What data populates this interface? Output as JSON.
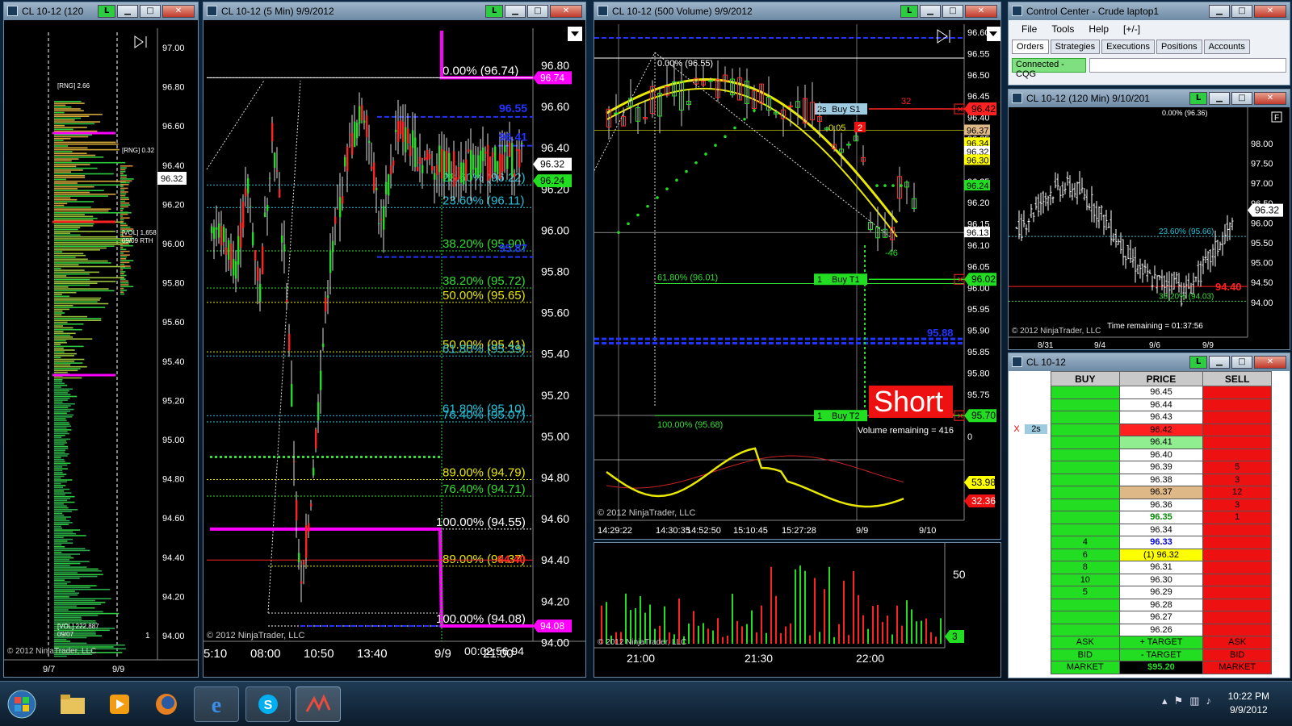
{
  "win1": {
    "title": "CL 10-12 (120",
    "prices": [
      "97.00",
      "96.80",
      "96.60",
      "96.40",
      "96.20",
      "96.00",
      "95.80",
      "95.60",
      "95.40",
      "95.20",
      "95.00",
      "94.80",
      "94.60",
      "94.40",
      "94.20",
      "94.00"
    ],
    "last": "96.32",
    "rng1": "[RNG] 2.66",
    "rng2": "[RNG] 0.32",
    "vol1": "[VOL] 1,658",
    "vol1b": "09/09 RTH",
    "vol2": "[VOL] 222,887",
    "vol2b": "09/07",
    "one": "1",
    "dates": [
      "9/7",
      "9/9"
    ],
    "copyright": "© 2012 NinjaTrader, LLC"
  },
  "win2": {
    "title": "CL 10-12 (5 Min)  9/9/2012",
    "prices": [
      "96.80",
      "96.60",
      "96.40",
      "96.20",
      "96.00",
      "95.80",
      "95.60",
      "95.40",
      "95.20",
      "95.00",
      "94.80",
      "94.60",
      "94.40",
      "94.20",
      "94.00"
    ],
    "times": [
      "5:10",
      "08:00",
      "10:50",
      "13:40",
      "9/9",
      "21:00"
    ],
    "fibs": [
      {
        "label": "0.00% (96.74)",
        "color": "#ffffff"
      },
      {
        "label": "23.60% (96.22)",
        "color": "#27c1d9"
      },
      {
        "label": "23.60% (96.11)",
        "color": "#27c1d9"
      },
      {
        "label": "38.20% (95.90)",
        "color": "#33dd33"
      },
      {
        "label": "38.20% (95.72)",
        "color": "#33dd33"
      },
      {
        "label": "50.00% (95.65)",
        "color": "#e8e800"
      },
      {
        "label": "50.00% (95.41)",
        "color": "#e8e800"
      },
      {
        "label": "61.80% (95.39)",
        "color": "#27c1d9"
      },
      {
        "label": "61.80% (95.10)",
        "color": "#27c1d9"
      },
      {
        "label": "76.40% (95.07)",
        "color": "#27c1d9"
      },
      {
        "label": "89.00% (94.79)",
        "color": "#e8e800"
      },
      {
        "label": "76.40% (94.71)",
        "color": "#33dd33"
      },
      {
        "label": "100.00% (94.55)",
        "color": "#ffffff"
      },
      {
        "label": "89.00% (94.37)",
        "color": "#e8e800"
      },
      {
        "label": "100.00% (94.08)",
        "color": "#ffffff"
      }
    ],
    "tags": {
      "hi": "96.74",
      "last": "96.32",
      "green": "96.24",
      "lo": "94.08",
      "b1": "96.55",
      "b2": "96.41",
      "b3": "95.87",
      "red": "94.40"
    },
    "timer": "00:02:56.94",
    "copyright": "© 2012 NinjaTrader, LLC"
  },
  "win3": {
    "title": "CL 10-12 (500 Volume)  9/9/2012",
    "prices": [
      "96.60",
      "96.55",
      "96.50",
      "96.45",
      "96.40",
      "96.35",
      "96.30",
      "96.25",
      "96.20",
      "96.15",
      "96.10",
      "96.05",
      "96.00",
      "95.95",
      "95.90",
      "95.85",
      "95.80",
      "95.75"
    ],
    "fib_top": "0.00% (96.55)",
    "fib_mid": "61.80% (96.01)",
    "fib_bot": "100.00% (95.68)",
    "orders": [
      {
        "qty": "2s",
        "label": "Buy S1",
        "price": "96.42",
        "color": "#ff2222"
      },
      {
        "qty": "1",
        "label": "Buy T1",
        "price": "96.02",
        "color": "#22dd22"
      },
      {
        "qty": "1",
        "label": "Buy T2",
        "price": "95.70",
        "color": "#22dd22"
      }
    ],
    "price_tags": [
      "96.37",
      "96.34",
      "96.32",
      "96.30",
      "96.24",
      "96.13"
    ],
    "pnl_top": "32",
    "pnl_bot": "-46",
    "small_val": "0.05",
    "small_qty": "2",
    "short_label": "Short",
    "blue_price": "95.88",
    "vol_remaining": "Volume remaining = 416",
    "zero": "0",
    "osc_vals": [
      "53.98",
      "32.36"
    ],
    "times": [
      "14:29:22",
      "14:30:35",
      "14:52:50",
      "15:10:45",
      "15:27:28",
      "9/9",
      "9/10"
    ],
    "copyright": "© 2012 NinjaTrader, LLC"
  },
  "win4": {
    "times": [
      "21:00",
      "21:30",
      "22:00"
    ],
    "scale": "50",
    "last": "3",
    "copyright": "© 2012 NinjaTrader, LLC"
  },
  "cc": {
    "title": "Control Center - Crude laptop1",
    "menu": [
      "File",
      "Tools",
      "Help",
      "[+/-]"
    ],
    "tabs": [
      "Orders",
      "Strategies",
      "Executions",
      "Positions",
      "Accounts"
    ],
    "status": "Connected - CQG"
  },
  "win6": {
    "title": "CL 10-12 (120 Min)  9/10/201",
    "prices": [
      "98.00",
      "97.50",
      "97.00",
      "96.50",
      "96.00",
      "95.50",
      "95.00",
      "94.50",
      "94.00"
    ],
    "last": "96.32",
    "fib1": "23.60% (95.66)",
    "fib2": "38.20% (94.03)",
    "red": "94.40",
    "top": "0.00% (96.36)",
    "timer": "Time remaining = 01:37:56",
    "dates": [
      "8/31",
      "9/4",
      "9/6",
      "9/9"
    ],
    "copyright": "© 2012 NinjaTrader, LLC",
    "f": "F"
  },
  "dom": {
    "title": "CL 10-12",
    "headers": [
      "BUY",
      "PRICE",
      "SELL"
    ],
    "rows": [
      {
        "x": "",
        "tag": "",
        "buy": "",
        "price": "96.45",
        "sell": "",
        "pbg": "#ffffff",
        "pc": "#000000"
      },
      {
        "x": "",
        "tag": "",
        "buy": "",
        "price": "96.44",
        "sell": "",
        "pbg": "#ffffff",
        "pc": "#000000"
      },
      {
        "x": "",
        "tag": "",
        "buy": "",
        "price": "96.43",
        "sell": "",
        "pbg": "#ffffff",
        "pc": "#000000"
      },
      {
        "x": "X",
        "tag": "2s",
        "buy": "",
        "price": "96.42",
        "sell": "",
        "pbg": "#ff2020",
        "pc": "#000000"
      },
      {
        "x": "",
        "tag": "",
        "buy": "",
        "price": "96.41",
        "sell": "",
        "pbg": "#90ee90",
        "pc": "#000000"
      },
      {
        "x": "",
        "tag": "",
        "buy": "",
        "price": "96.40",
        "sell": "",
        "pbg": "#ffffff",
        "pc": "#000000"
      },
      {
        "x": "",
        "tag": "",
        "buy": "",
        "price": "96.39",
        "sell": "5",
        "pbg": "#ffffff",
        "pc": "#000000"
      },
      {
        "x": "",
        "tag": "",
        "buy": "",
        "price": "96.38",
        "sell": "3",
        "pbg": "#ffffff",
        "pc": "#000000"
      },
      {
        "x": "",
        "tag": "",
        "buy": "",
        "price": "96.37",
        "sell": "12",
        "pbg": "#deb887",
        "pc": "#000000"
      },
      {
        "x": "",
        "tag": "",
        "buy": "",
        "price": "96.36",
        "sell": "3",
        "pbg": "#ffffff",
        "pc": "#000000"
      },
      {
        "x": "",
        "tag": "",
        "buy": "",
        "price": "96.35",
        "sell": "1",
        "pbg": "#ffffff",
        "pc": "#008800"
      },
      {
        "x": "",
        "tag": "",
        "buy": "",
        "price": "96.34",
        "sell": "",
        "pbg": "#ffffff",
        "pc": "#000000"
      },
      {
        "x": "",
        "tag": "",
        "buy": "4",
        "price": "96.33",
        "sell": "",
        "pbg": "#ffffff",
        "pc": "#0000dd"
      },
      {
        "x": "",
        "tag": "",
        "buy": "6",
        "price": "(1) 96.32",
        "sell": "",
        "pbg": "#ffff00",
        "pc": "#000000"
      },
      {
        "x": "",
        "tag": "",
        "buy": "8",
        "price": "96.31",
        "sell": "",
        "pbg": "#ffffff",
        "pc": "#000000"
      },
      {
        "x": "",
        "tag": "",
        "buy": "10",
        "price": "96.30",
        "sell": "",
        "pbg": "#ffffff",
        "pc": "#000000"
      },
      {
        "x": "",
        "tag": "",
        "buy": "5",
        "price": "96.29",
        "sell": "",
        "pbg": "#ffffff",
        "pc": "#000000"
      },
      {
        "x": "",
        "tag": "",
        "buy": "",
        "price": "96.28",
        "sell": "",
        "pbg": "#ffffff",
        "pc": "#000000"
      },
      {
        "x": "",
        "tag": "",
        "buy": "",
        "price": "96.27",
        "sell": "",
        "pbg": "#ffffff",
        "pc": "#000000"
      },
      {
        "x": "",
        "tag": "",
        "buy": "",
        "price": "96.26",
        "sell": "",
        "pbg": "#ffffff",
        "pc": "#000000"
      }
    ],
    "footer": [
      {
        "buy": "ASK",
        "price": "+ TARGET",
        "sell": "ASK"
      },
      {
        "buy": "BID",
        "price": "- TARGET",
        "sell": "BID"
      },
      {
        "buy": "MARKET",
        "price": "$95.20",
        "sell": "MARKET"
      }
    ]
  },
  "taskbar": {
    "time": "10:22 PM",
    "date": "9/9/2012"
  },
  "colors": {
    "up": "#22dd22",
    "down": "#ff2222",
    "magenta": "#ff00ff",
    "blue": "#2222ff",
    "yellow": "#e8e800",
    "cyan": "#27c1d9"
  }
}
